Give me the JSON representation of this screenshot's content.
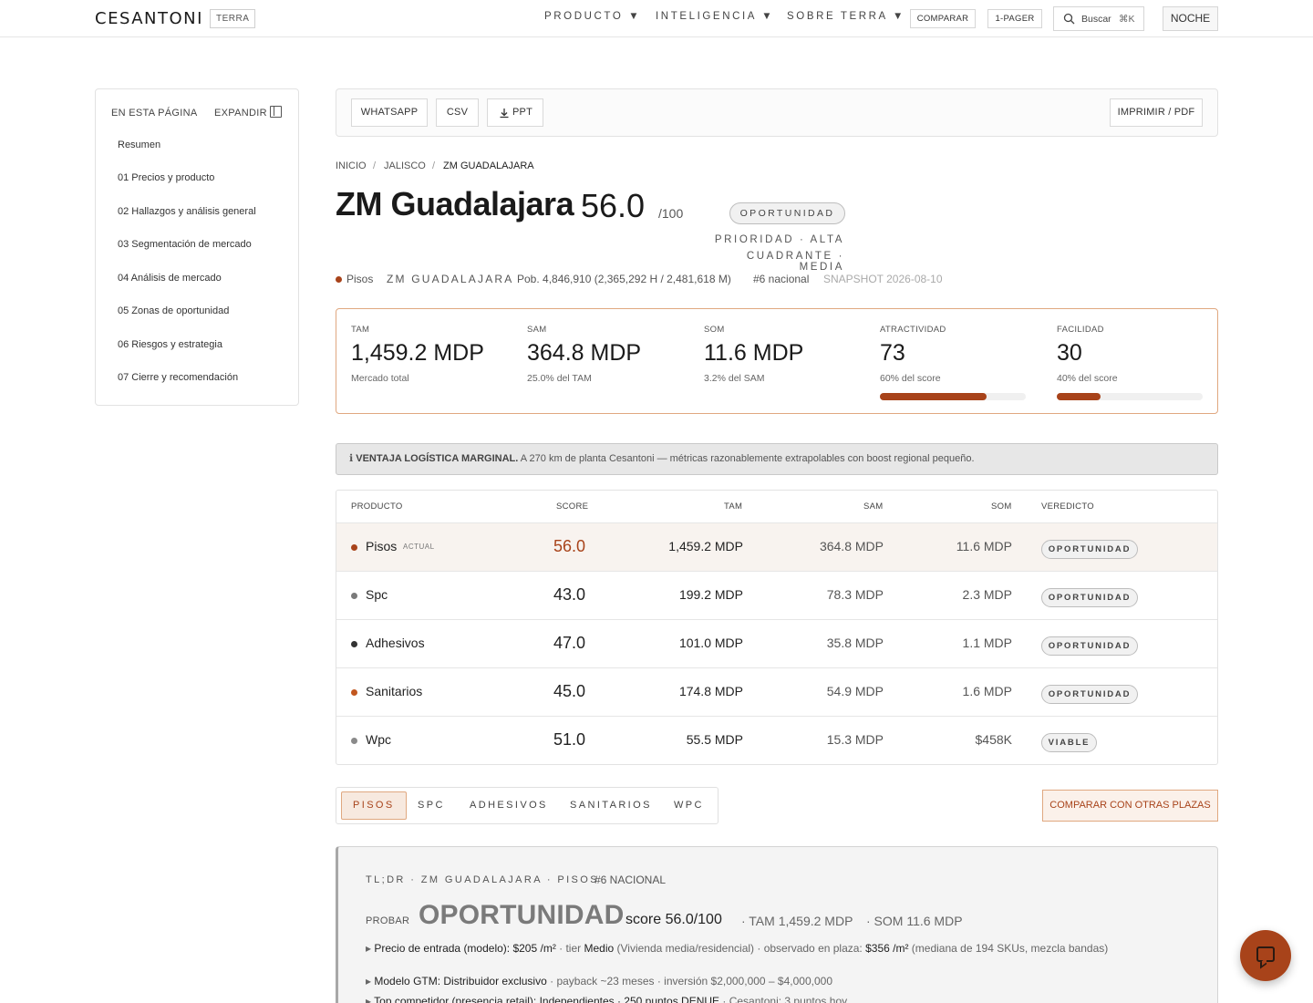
{
  "header": {
    "brand": "CESANTONI",
    "badge": "TERRA",
    "menus": [
      "PRODUCTO ▼",
      "INTELIGENCIA ▼",
      "SOBRE TERRA ▼"
    ],
    "buttons": {
      "compare": "COMPARAR",
      "onepager": "1-PAGER"
    },
    "search": {
      "label": "Buscar",
      "shortcut": "⌘K"
    },
    "theme_toggle": "NOCHE"
  },
  "toc": {
    "title": "EN ESTA PÁGINA",
    "expand": "EXPANDIR",
    "items": [
      "Resumen",
      "01 Precios y producto",
      "02 Hallazgos y análisis general",
      "03 Segmentación de mercado",
      "04 Análisis de mercado",
      "05 Zonas de oportunidad",
      "06 Riesgos y estrategia",
      "07 Cierre y recomendación"
    ]
  },
  "actions": {
    "whatsapp": "WHATSAPP",
    "csv": "CSV",
    "ppt": "PPT",
    "print": "IMPRIMIR / PDF"
  },
  "breadcrumb": {
    "home": "INICIO",
    "state": "JALISCO",
    "current": "ZM GUADALAJARA",
    "separator": "/"
  },
  "title": {
    "name": "ZM Guadalajara",
    "score": "56.0",
    "out_of": "/100",
    "status": "OPORTUNIDAD",
    "priority": "PRIORIDAD · ALTA",
    "quadrant": "CUADRANTE · MEDIA"
  },
  "meta": {
    "product": "Pisos",
    "region": "ZM GUADALAJARA",
    "population": "Pob. 4,846,910 (2,365,292 H / 2,481,618 M)",
    "rank": "#6 nacional",
    "snapshot": "SNAPSHOT 2026-08-10"
  },
  "kpis": [
    {
      "label": "TAM",
      "value": "1,459.2 MDP",
      "sub": "Mercado total"
    },
    {
      "label": "SAM",
      "value": "364.8 MDP",
      "sub": "25.0% del TAM"
    },
    {
      "label": "SOM",
      "value": "11.6 MDP",
      "sub": "3.2% del SAM"
    },
    {
      "label": "ATRACTIVIDAD",
      "value": "73",
      "sub": "60% del score",
      "progress": 0.73
    },
    {
      "label": "FACILIDAD",
      "value": "30",
      "sub": "40% del score",
      "progress": 0.3
    }
  ],
  "banner": {
    "icon": "ℹ",
    "bold": "VENTAJA LOGÍSTICA MARGINAL.",
    "text": " A 270 km de planta Cesantoni — métricas razonablemente extrapolables con boost regional pequeño."
  },
  "table": {
    "headers": {
      "product": "PRODUCTO",
      "score": "SCORE",
      "tam": "TAM",
      "sam": "SAM",
      "som": "SOM",
      "verdict": "VEREDICTO"
    },
    "current_tag": "ACTUAL",
    "rows": [
      {
        "product": "Pisos",
        "score": "56.0",
        "tam": "1,459.2 MDP",
        "sam": "364.8 MDP",
        "som": "11.6 MDP",
        "verdict": "OPORTUNIDAD",
        "dot": "#a8431a"
      },
      {
        "product": "Spc",
        "score": "43.0",
        "tam": "199.2 MDP",
        "sam": "78.3 MDP",
        "som": "2.3 MDP",
        "verdict": "OPORTUNIDAD",
        "dot": "#7a7a7a"
      },
      {
        "product": "Adhesivos",
        "score": "47.0",
        "tam": "101.0 MDP",
        "sam": "35.8 MDP",
        "som": "1.1 MDP",
        "verdict": "OPORTUNIDAD",
        "dot": "#333333"
      },
      {
        "product": "Sanitarios",
        "score": "45.0",
        "tam": "174.8 MDP",
        "sam": "54.9 MDP",
        "som": "1.6 MDP",
        "verdict": "OPORTUNIDAD",
        "dot": "#c2571f"
      },
      {
        "product": "Wpc",
        "score": "51.0",
        "tam": "55.5 MDP",
        "sam": "15.3 MDP",
        "som": "$458K",
        "verdict": "VIABLE",
        "dot": "#8a8a8a"
      }
    ]
  },
  "tabs": [
    "PISOS",
    "SPC",
    "ADHESIVOS",
    "SANITARIOS",
    "WPC"
  ],
  "compare_button": "COMPARAR CON OTRAS PLAZAS",
  "tldr": {
    "head": "TL;DR · ZM GUADALAJARA · PISOS",
    "rank": "#6 NACIONAL",
    "action": "PROBAR",
    "verdict": "OPORTUNIDAD",
    "score": "score 56.0/100",
    "tam": "· TAM 1,459.2 MDP",
    "som": "· SOM 11.6 MDP",
    "line1": {
      "bullet": "▸",
      "k1": "Precio de entrada (modelo): $205 /m²",
      "t1": " · tier ",
      "k2": "Medio",
      "t2": " (Vivienda media/residencial) · observado en plaza: ",
      "k3": "$356 /m²",
      "t3": " (mediana de 194 SKUs, mezcla bandas)"
    },
    "line2": {
      "bullet": "▸",
      "k1": "Modelo GTM: Distribuidor exclusivo",
      "t1": " · payback ~23 meses · inversión $2,000,000 – $4,000,000"
    },
    "line3": {
      "bullet": "▸",
      "k1": "Top competidor (presencia retail): Independientes · 250 puntos DENUE",
      "t1": " · Cesantoni: 3 puntos hoy"
    }
  },
  "colors": {
    "accent": "#a8431a",
    "accent_soft": "#f7e9df",
    "border": "#e2e2e2"
  }
}
